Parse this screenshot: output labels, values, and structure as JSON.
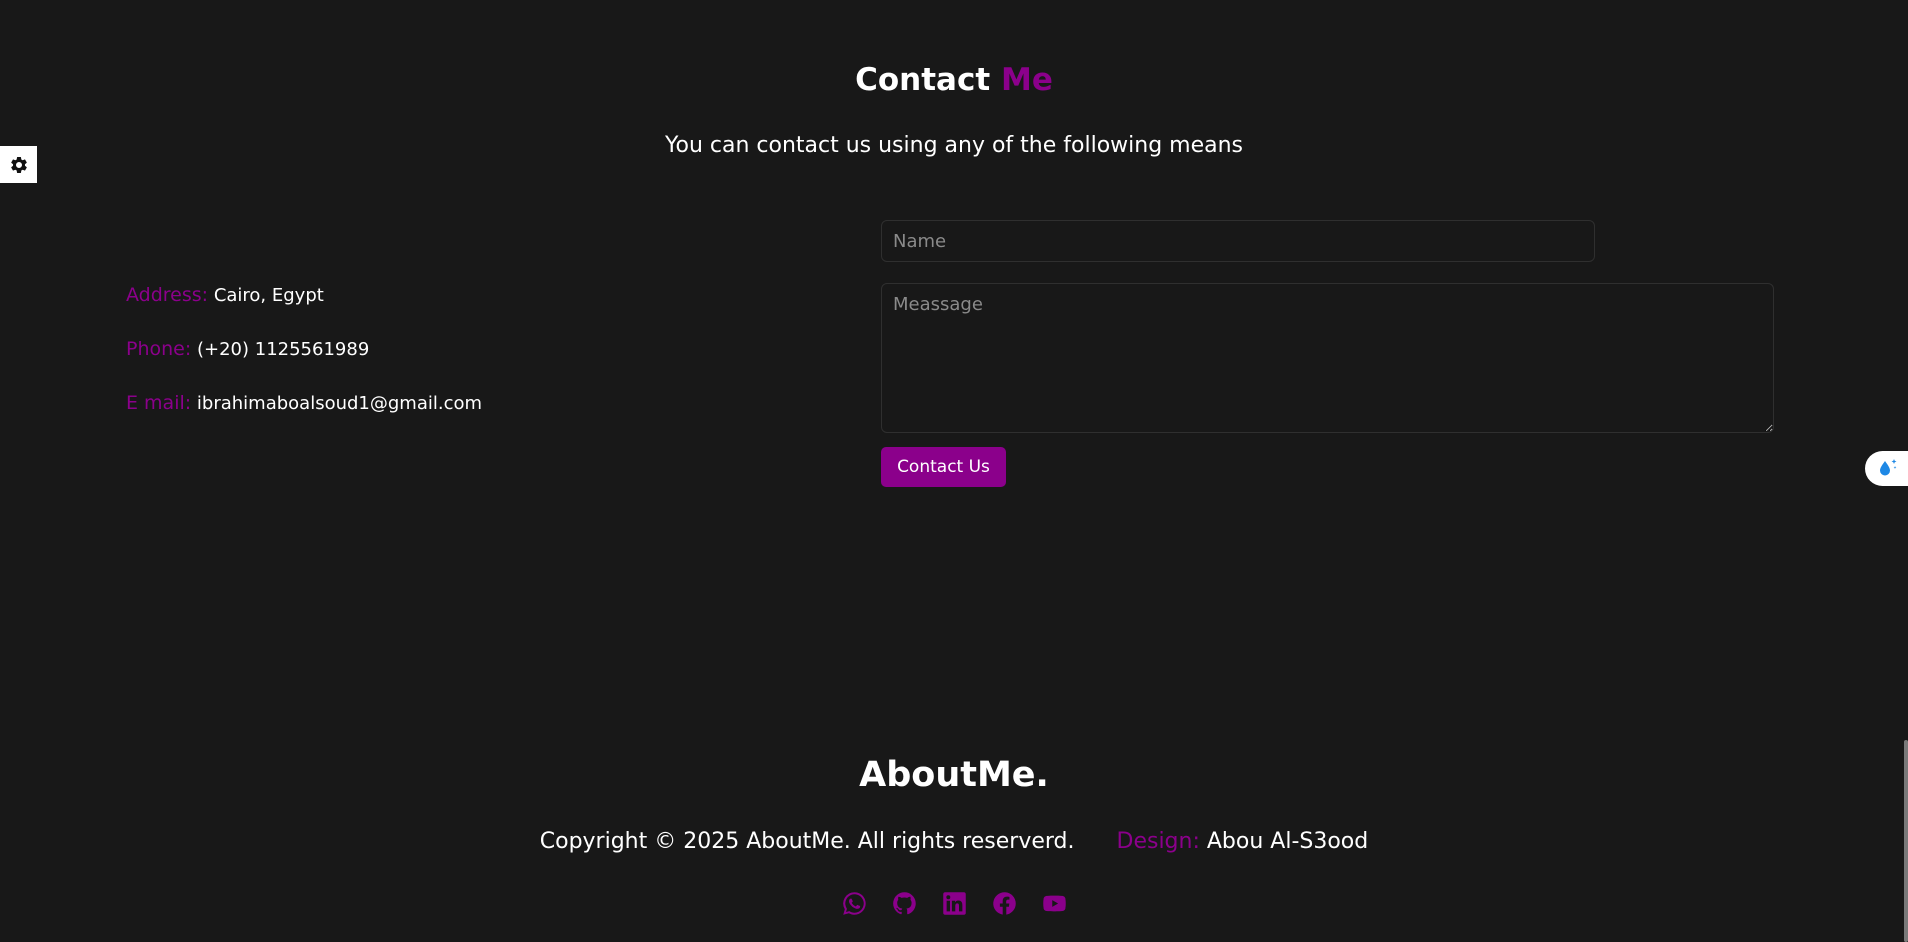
{
  "settings": {
    "icon": "gear-icon"
  },
  "contact": {
    "title_main": "Contact",
    "title_accent": "Me",
    "subtitle": "You can contact us using any of the following means",
    "info": [
      {
        "label": "Address:",
        "value": "Cairo, Egypt"
      },
      {
        "label": "Phone:",
        "value": "(+20) 1125561989"
      },
      {
        "label": "E mail:",
        "value": "ibrahimaboalsoud1@gmail.com"
      }
    ],
    "form": {
      "name_placeholder": "Name",
      "name_value": "",
      "message_placeholder": "Meassage",
      "message_value": "",
      "submit_label": "Contact Us"
    }
  },
  "footer": {
    "brand": "AboutMe.",
    "copyright": "Copyright © 2025 AboutMe. All rights reserverd.",
    "design_label": "Design:",
    "design_value": "Abou Al-S3ood",
    "socials": [
      "whatsapp-icon",
      "github-icon",
      "linkedin-icon",
      "facebook-icon",
      "youtube-icon"
    ]
  },
  "colors": {
    "background": "#181818",
    "accent": "#8b008b",
    "text": "#ffffff",
    "border": "#2f2f2f"
  }
}
